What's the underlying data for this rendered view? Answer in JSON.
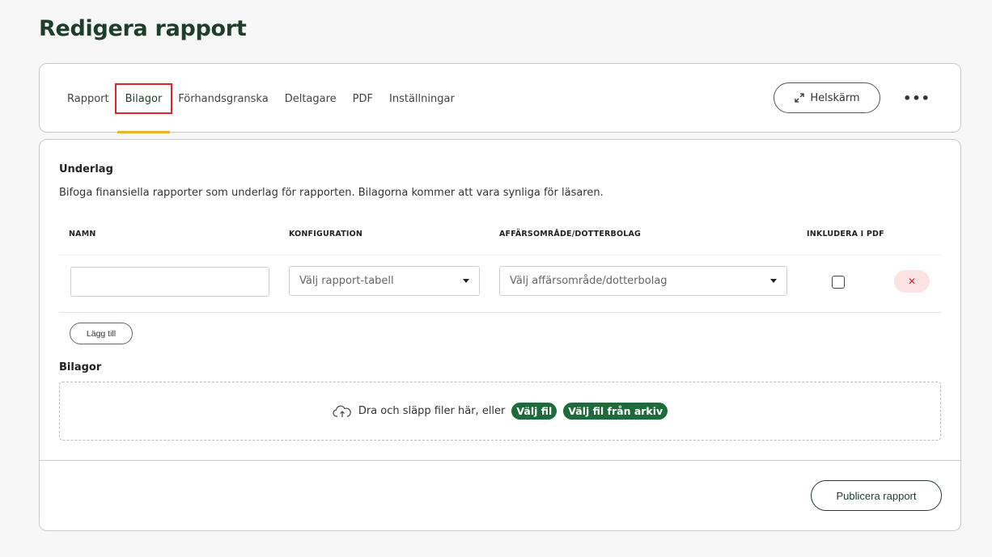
{
  "page": {
    "title": "Redigera rapport"
  },
  "tabs": [
    {
      "label": "Rapport",
      "active": false
    },
    {
      "label": "Bilagor",
      "active": true
    },
    {
      "label": "Förhandsgranska",
      "active": false
    },
    {
      "label": "Deltagare",
      "active": false
    },
    {
      "label": "PDF",
      "active": false
    },
    {
      "label": "Inställningar",
      "active": false
    }
  ],
  "toolbar": {
    "fullscreen_label": "Helskärm",
    "more_label": "•••"
  },
  "underlag": {
    "title": "Underlag",
    "description": "Bifoga finansiella rapporter som underlag för rapporten. Bilagorna kommer att vara synliga för läsaren.",
    "columns": {
      "name": "NAMN",
      "config": "KONFIGURATION",
      "area": "AFFÄRSOMRÅDE/DOTTERBOLAG",
      "include_pdf": "INKLUDERA I PDF"
    },
    "row": {
      "name_value": "",
      "config_placeholder": "Välj rapport-tabell",
      "area_placeholder": "Välj affärsområde/dotterbolag",
      "include_pdf": false,
      "remove_label": "✕"
    },
    "add_label": "Lägg till"
  },
  "bilagor": {
    "title": "Bilagor",
    "drop_text": "Dra och släpp filer här, eller",
    "choose_file": "Välj fil",
    "choose_archive": "Välj fil från arkiv"
  },
  "footer": {
    "publish_label": "Publicera rapport"
  },
  "colors": {
    "accent_green": "#1c6b3a",
    "title_green": "#1f3d2b",
    "active_tab_underline": "#e8b61f",
    "highlight_red": "#e0242b",
    "remove_bg": "#fbe3e3"
  }
}
